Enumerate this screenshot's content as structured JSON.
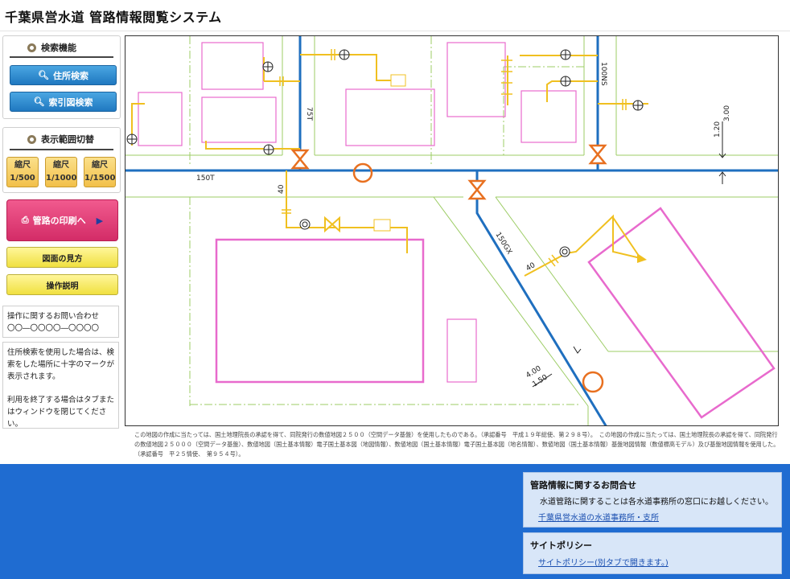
{
  "app": {
    "title": "千葉県営水道 管路情報閲覧システム"
  },
  "search_panel": {
    "title": "検索機能",
    "address_search": "住所検索",
    "index_search": "索引図検索"
  },
  "scale_panel": {
    "title": "表示範囲切替",
    "scales": [
      {
        "top": "縮尺",
        "bottom": "1/500"
      },
      {
        "top": "縮尺",
        "bottom": "1/1000"
      },
      {
        "top": "縮尺",
        "bottom": "1/1500"
      }
    ]
  },
  "actions": {
    "print": "管路の印刷へ",
    "legend": "図面の見方",
    "manual": "操作説明"
  },
  "inquiry_box": {
    "label": "操作に関するお問い合わせ",
    "phone": "〇〇―〇〇〇〇―〇〇〇〇"
  },
  "help_box": {
    "para1": "住所検索を使用した場合は、検索をした場所に十字のマークが表示されます。",
    "para2": "利用を終了する場合はタブまたはウィンドウを閉じてください。"
  },
  "map": {
    "labels": {
      "pipe_75t": "75T",
      "pipe_100ns": "100NS",
      "pipe_150t": "150T",
      "pipe_150gx": "150GX",
      "service_40_a": "40",
      "service_40_b": "40",
      "depth_a_top": "3.00",
      "depth_a_bottom": "1.20",
      "depth_b_top": "4.00",
      "depth_b_bottom": "1.50"
    },
    "colors": {
      "main_pipe": "#1f6fbf",
      "service_pipe": "#f0c020",
      "building": "#e86acd",
      "lot_line": "#9ccc64",
      "valve": "#e87020"
    }
  },
  "credit_text": "この地図の作成に当たっては、国土地理院長の承認を得て、同院発行の数値地図２５００（空間データ基盤）を使用したものである。（承認番号　平成１９年総使、第２９８号）。　この地図の作成に当たっては、国土地理院長の承認を得て、同院発行の数値地図２５０００（空間データ基盤）、数値地図（国土基本情報）電子国土基本図（地図情報）、数値地図（国土基本情報）電子国土基本図（地名情報）、数値地図（国土基本情報）基盤地図情報（数値標高モデル）及び基盤地図情報を使用した。（承認番号　平２５情使、　第９５４号）。",
  "footer": {
    "contact": {
      "title": "管路情報に関するお問合せ",
      "text": "水道管路に関することは各水道事務所の窓口にお越しください。",
      "link": "千葉県営水道の水道事務所・支所"
    },
    "policy": {
      "title": "サイトポリシー",
      "link": "サイトポリシー(別タブで開きます。)"
    }
  }
}
